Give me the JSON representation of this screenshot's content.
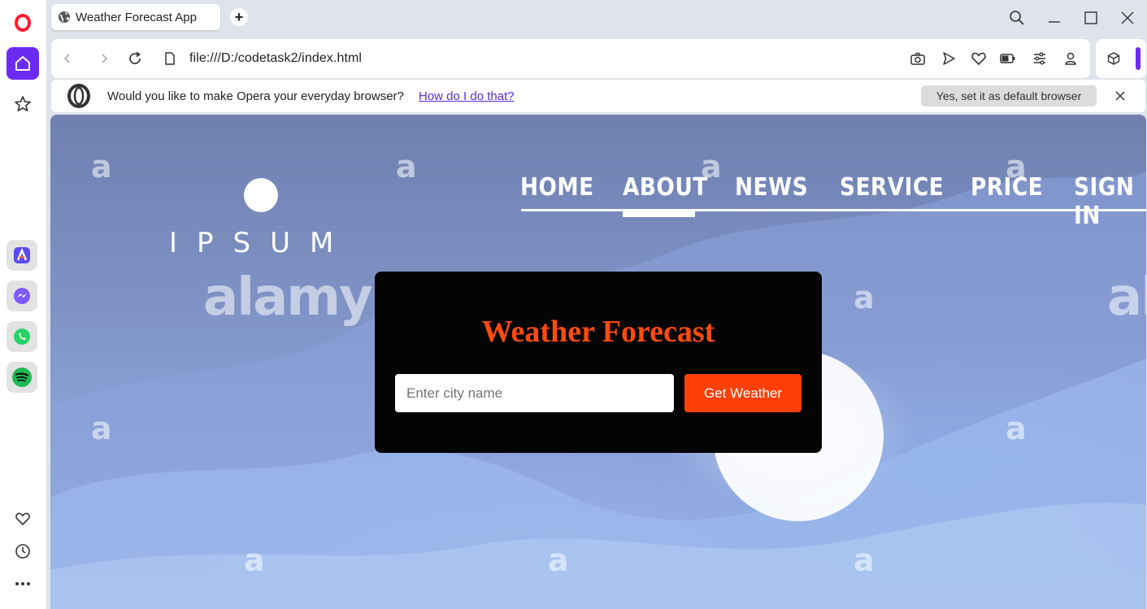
{
  "browser": {
    "tab": {
      "title": "Weather Forecast App",
      "icon": "globe-icon"
    },
    "new_tab_label": "+",
    "address": {
      "url": "file:///D:/codetask2/index.html"
    },
    "infobar": {
      "message": "Would you like to make Opera your everyday browser?",
      "link": "How do I do that?",
      "button": "Yes, set it as default browser"
    },
    "accent": "#6c2bf5"
  },
  "page": {
    "logo_text": "IPSUM",
    "watermark": "alamy",
    "watermark_letter": "a",
    "nav": [
      "HOME",
      "ABOUT",
      "NEWS",
      "SERVICE",
      "PRICE",
      "SIGN IN"
    ],
    "nav_active": "ABOUT",
    "card": {
      "title": "Weather Forecast",
      "input_placeholder": "Enter city name",
      "button_label": "Get Weather",
      "title_color": "#ff4a10",
      "button_color": "#ff3f06"
    }
  }
}
